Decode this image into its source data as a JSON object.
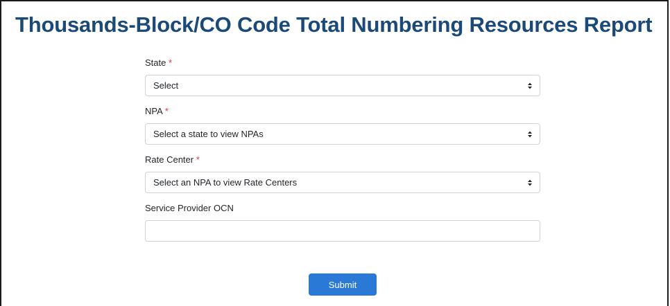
{
  "page": {
    "title": "Thousands-Block/CO Code Total Numbering Resources Report"
  },
  "form": {
    "required_marker": "*",
    "state": {
      "label": "State",
      "selected": "Select"
    },
    "npa": {
      "label": "NPA",
      "selected": "Select a state to view NPAs"
    },
    "rate_center": {
      "label": "Rate Center",
      "selected": "Select an NPA to view Rate Centers"
    },
    "ocn": {
      "label": "Service Provider OCN",
      "value": ""
    },
    "submit_label": "Submit"
  },
  "colors": {
    "title": "#1b4a78",
    "required": "#dc3545",
    "button": "#2a79d6",
    "input_border": "#ced4da"
  },
  "icons": {
    "select_caret": "sort-caret-icon"
  }
}
